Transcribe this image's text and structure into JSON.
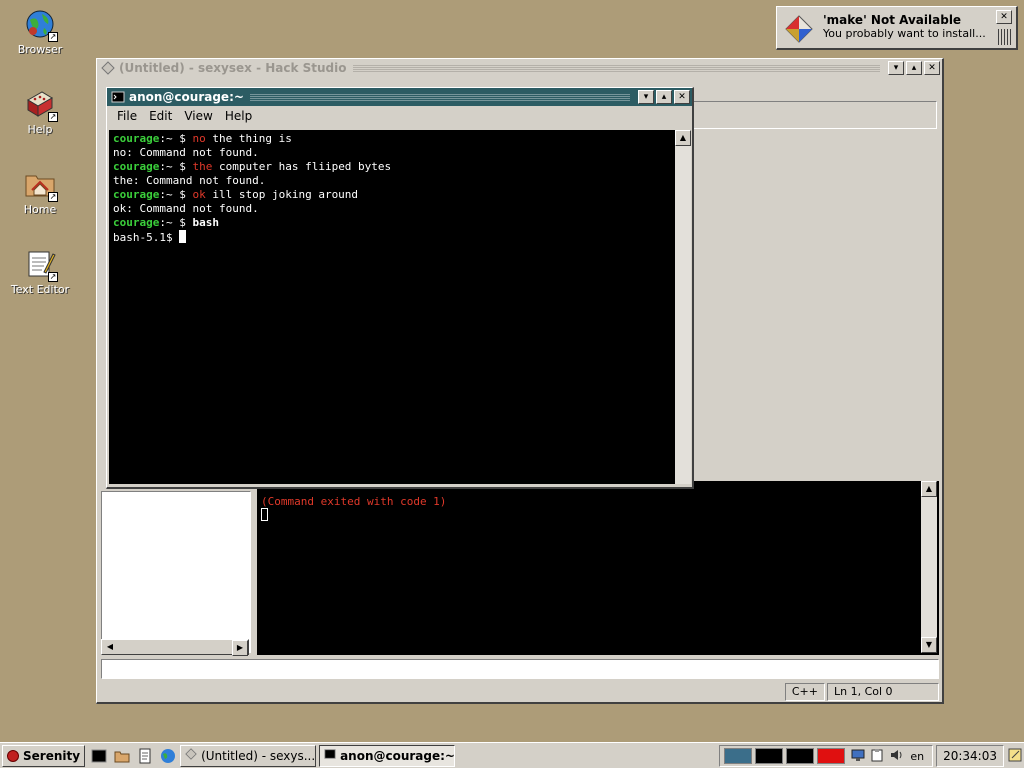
{
  "desktop": {
    "icons": [
      {
        "label": "Browser",
        "icon": "globe-icon"
      },
      {
        "label": "Help",
        "icon": "help-book-icon"
      },
      {
        "label": "Home",
        "icon": "home-folder-icon"
      },
      {
        "label": "Text Editor",
        "icon": "text-editor-icon"
      }
    ]
  },
  "notification": {
    "title": "'make' Not Available",
    "text": "You probably want to install..."
  },
  "hack_studio": {
    "title": "(Untitled) - sexysex - Hack Studio",
    "console_lines": [
      "(Command exited with code 1)"
    ],
    "status": {
      "language": "C++",
      "position": "Ln 1, Col 0"
    }
  },
  "terminal": {
    "title": "anon@courage:~",
    "menu": [
      "File",
      "Edit",
      "View",
      "Help"
    ],
    "prompt_user": "courage",
    "prompt_tail": ":~ $ ",
    "lines": [
      {
        "type": "cmd",
        "cmd": "no",
        "args": " the thing is"
      },
      {
        "type": "out",
        "text": "no: Command not found."
      },
      {
        "type": "cmd",
        "cmd": "the",
        "args": " computer has fliiped bytes"
      },
      {
        "type": "out",
        "text": "the: Command not found."
      },
      {
        "type": "cmd",
        "cmd": "ok",
        "args": " ill stop joking around"
      },
      {
        "type": "out",
        "text": "ok: Command not found."
      },
      {
        "type": "cmd_bold",
        "cmd": "bash",
        "args": ""
      }
    ],
    "current_prompt": "bash-5.1$ "
  },
  "taskbar": {
    "start_label": "Serenity",
    "tasks": [
      {
        "label": "(Untitled) - sexys...",
        "active": false
      },
      {
        "label": "anon@courage:~",
        "active": true
      }
    ],
    "workspace_colors": [
      "#3b6e8a",
      "#000000",
      "#000000",
      "#e01010"
    ],
    "keyboard_layout": "en",
    "clock": "20:34:03"
  },
  "colors": {
    "desktop": "#ad9c78",
    "active_title": "#2c5c63",
    "prompt_green": "#3bcf3b",
    "error_red": "#e0392a"
  }
}
